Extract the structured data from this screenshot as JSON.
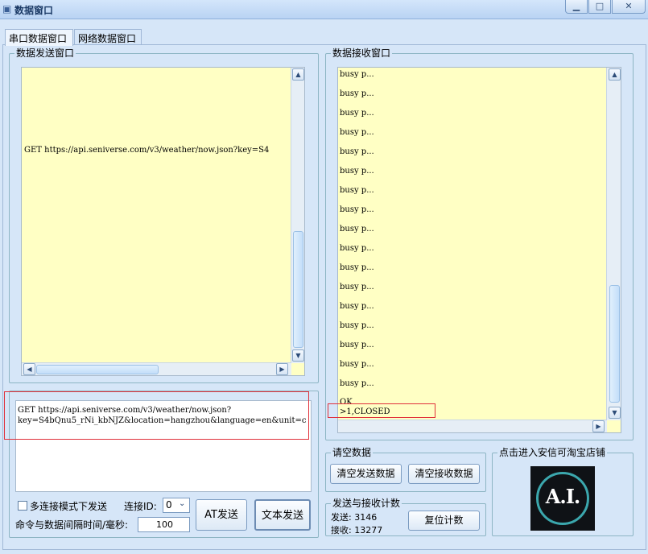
{
  "window": {
    "title": "数据窗口",
    "minimize": "▁",
    "maximize": "□",
    "close": "✕"
  },
  "tabs": [
    {
      "label": "串口数据窗口"
    },
    {
      "label": "网络数据窗口"
    }
  ],
  "send_window": {
    "label": "数据发送窗口",
    "line": "GET https://api.seniverse.com/v3/weather/now.json?key=S4"
  },
  "receive_window": {
    "label": "数据接收窗口",
    "lines": [
      "busy p...",
      "busy p...",
      "busy p...",
      "busy p...",
      "busy p...",
      "busy p...",
      "busy p...",
      "busy p...",
      "busy p...",
      "busy p...",
      "busy p...",
      "busy p...",
      "busy p...",
      "busy p...",
      "busy p...",
      "busy p...",
      "busy p..."
    ],
    "ok": "OK",
    "closed": ">1,CLOSED"
  },
  "command_input": {
    "line1": "GET https://api.seniverse.com/v3/weather/now.json?",
    "line2": "key=S4bQnu5_rNi_kbNJZ&location=hangzhou&language=en&unit=c"
  },
  "multi_connect": {
    "label": "多连接模式下发送",
    "checked": false
  },
  "connection_id": {
    "label": "连接ID:",
    "value": "0"
  },
  "interval": {
    "label": "命令与数据间隔时间/毫秒:",
    "value": "100"
  },
  "buttons": {
    "at_send": "AT发送",
    "text_send": "文本发送"
  },
  "clear_group": {
    "label": "请空数据",
    "clear_send": "清空发送数据",
    "clear_receive": "清空接收数据"
  },
  "count_group": {
    "label": "发送与接收计数",
    "sent": "发送: 3146",
    "received": "接收: 13277",
    "reset": "复位计数"
  },
  "shop_group": {
    "label": "点击进入安信可淘宝店铺",
    "logo_text": "A.I."
  },
  "scroll_glyphs": {
    "up": "▲",
    "down": "▼",
    "left": "◀",
    "right": "▶"
  },
  "colors": {
    "text_area": "#ffffc4",
    "window_bg": "#d6e6f8",
    "highlight": "#e0303a"
  }
}
